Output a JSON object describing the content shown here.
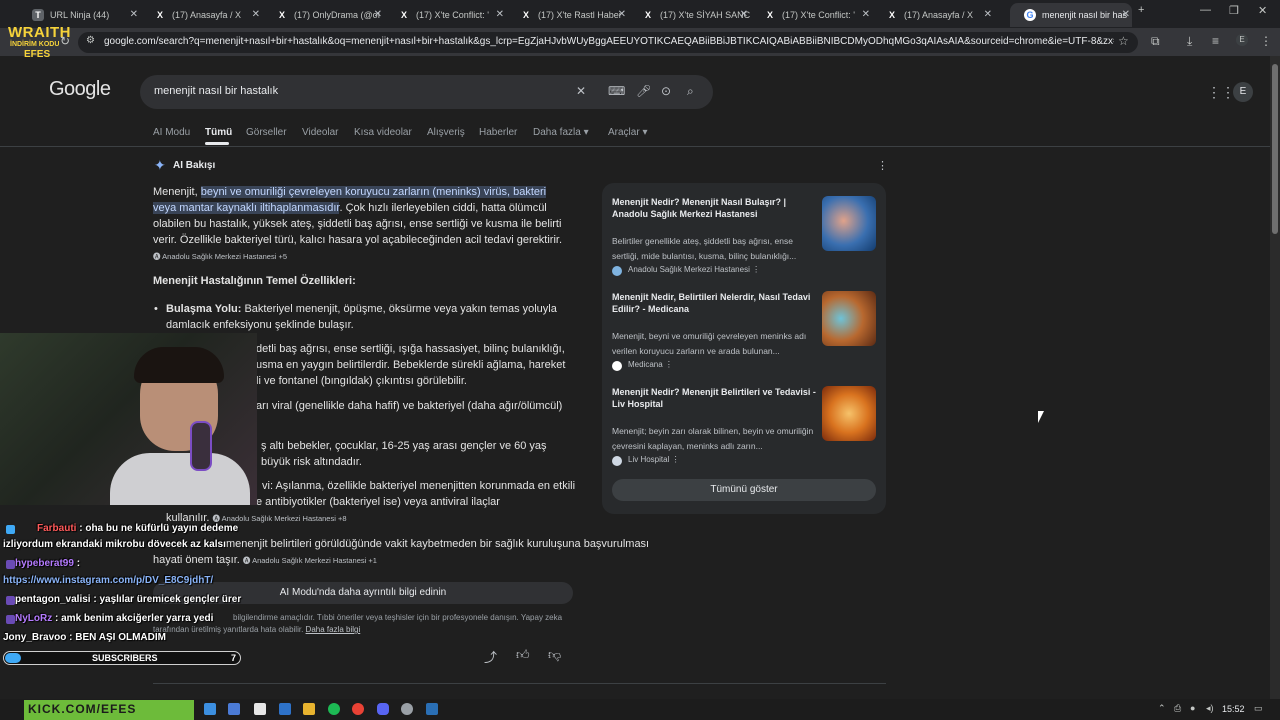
{
  "tabs": [
    {
      "title": "URL Ninja (44)",
      "icon": "T"
    },
    {
      "title": "(17) Anasayfa / X",
      "icon": "X"
    },
    {
      "title": "(17) OnlyDrama (@oı",
      "icon": "X"
    },
    {
      "title": "(17) X'te Conflict: '",
      "icon": "X"
    },
    {
      "title": "(17) X'te Rastl Haber",
      "icon": "X"
    },
    {
      "title": "(17) X'te SİYAH SANC",
      "icon": "X"
    },
    {
      "title": "(17) X'te Conflict: '",
      "icon": "X"
    },
    {
      "title": "(17) Anasayfa / X",
      "icon": "X"
    },
    {
      "title": "menenjit nasıl bir has",
      "icon": "G"
    }
  ],
  "address_bar": {
    "url": "google.com/search?q=menenjit+nasıl+bir+hastalık&oq=menenjit+nasıl+bir+hastalık&gs_lcrp=EgZjaHJvbWUyBggAEEUYOTIKCAEQABiiBBiJBTIKCAIQABiABBiiBNIBCDMyODhqMGo3qAIAsAIA&sourceid=chrome&ie=UTF-8&zx=1774183755534..."
  },
  "search": {
    "logo": "Google",
    "query": "menenjit nasıl bir hastalık",
    "avatar_letter": "E"
  },
  "nav_tabs": [
    "AI Modu",
    "Tümü",
    "Görseller",
    "Videolar",
    "Kısa videolar",
    "Alışveriş",
    "Haberler",
    "Daha fazla",
    "Araçlar"
  ],
  "ai_overview": {
    "title": "AI Bakışı",
    "intro_lead": "Menenjit, ",
    "intro_highlight": "beyni ve omuriliği çevreleyen koruyucu zarların (meninks) virüs, bakteri veya mantar kaynaklı iltihaplanmasıdır",
    "intro_rest": ". Çok hızlı ilerleyebilen ciddi, hatta ölümcül olabilen bu hastalık, yüksek ateş, şiddetli baş ağrısı, ense sertliği ve kusma ile belirti verir. Özellikle bakteriyel türü, kalıcı hasara yol açabileceğinden acil tedavi gerektirir.",
    "intro_source": "Anadolu Sağlık Merkezi Hastanesi +5",
    "heading": "Menenjit Hastalığının Temel Özellikleri:",
    "bullet1_label": "Bulaşma Yolu:",
    "bullet1_text": " Bakteriyel menenjit, öpüşme, öksürme veya yakın temas yoluyla damlacık enfeksiyonu şeklinde bulaşır.",
    "frag1": "detli baş ağrısı, ense sertliği, ışığa hassasiyet, bilinç bulanıklığı,",
    "frag2": "usma en yaygın belirtilerdir. Bebeklerde sürekli ağlama, hareket",
    "frag3": "li ve fontanel (bıngıldak) çıkıntısı görülebilir.",
    "frag4": "arı viral (genellikle daha hafif) ve bakteriyel (daha ağır/ölümcül)",
    "frag5": "ş altı bebekler, çocuklar, 16-25 yaş arası gençler ve 60 yaş",
    "frag6": "büyük risk altındadır.",
    "frag7": "vi: Aşılanma, özellikle bakteriyel menenjitten korunmada en etkili",
    "frag8": "e antibiyotikler (bakteriyel ise) veya antiviral ilaçlar",
    "frag9": "kullanılır.",
    "frag9_source": "Anadolu Sağlık Merkezi Hastanesi +8",
    "frag10": "menenjit belirtileri görüldüğünde vakit kaybetmeden bir sağlık kuruluşuna başvurulması",
    "frag11": "hayati önem taşır.",
    "frag11_source": "Anadolu Sağlık Merkezi Hastanesi +1",
    "more_button": "AI Modu'nda daha ayrıntılı bilgi edinin",
    "disclaimer": "bilgilendirme amaçlıdır. Tıbbi öneriler veya teşhisler için bir profesyonele danışın. Yapay zeka tarafından üretilmiş yanıtlarda hata olabilir.",
    "disclaimer_link": "Daha fazla bilgi"
  },
  "sources": [
    {
      "title": "Menenjit Nedir? Menenjit Nasıl Bulaşır? | Anadolu Sağlık Merkezi Hastanesi",
      "snippet": "Belirtiler genellikle ateş, şiddetli baş ağrısı, ense sertliği, mide bulantısı, kusma, bilinç bulanıklığı...",
      "site": "Anadolu Sağlık Merkezi Hastanesi",
      "thumb_color": "#3a6fb0"
    },
    {
      "title": "Menenjit Nedir, Belirtileri Nelerdir, Nasıl Tedavi Edilir? - Medicana",
      "snippet": "Menenjit, beyni ve omuriliği çevreleyen meninks adı verilen koruyucu zarların ve arada bulunan...",
      "site": "Medicana",
      "thumb_color": "#b8682f"
    },
    {
      "title": "Menenjit Nedir? Menenjit Belirtileri ve Tedavisi - Liv Hospital",
      "snippet": "Menenjit; beyin zarı olarak bilinen, beyin ve omuriliğin çevresini kaplayan, meninks adlı zarın...",
      "site": "Liv Hospital",
      "thumb_color": "#d9731f"
    }
  ],
  "show_all": "Tümünü göster",
  "overlay": {
    "brand_line1": "WRAITH",
    "brand_line2": "İNDİRİM KODU",
    "brand_line3": "EFES",
    "chat": [
      {
        "user": "Farbauti",
        "message": ": oha bu ne küfürlü yayın dedeme",
        "user_color": "#ff5a5a"
      },
      {
        "user": "",
        "message": "izliyordum ekrandaki mikrobu dövecek az kalsı",
        "user_color": "#ffffff"
      },
      {
        "user": "hypeberat99",
        "message": " :",
        "user_color": "#b57bff"
      },
      {
        "user": "",
        "message": "https://www.instagram.com/p/DV_E8C9jdhT/",
        "user_color": "#8ab4f8"
      },
      {
        "user": "pentagon_valisi",
        "message": ": yaşlılar üremicek gençler ürer",
        "user_color": "#ffffff"
      },
      {
        "user": "NyLoRz",
        "message": ": amk benim akciğerler yarra yedi",
        "user_color": "#b57bff"
      },
      {
        "user": "Jony_Bravoo",
        "message": ": BEN AŞI OLMADIM",
        "user_color": "#ffffff"
      }
    ],
    "subscribers_label": "SUBSCRIBERS",
    "subscribers_count": "7",
    "bottom_banner": "KICK.COM/EFES"
  },
  "taskbar": {
    "time": "15:52"
  },
  "colors": {
    "background": "#1f1f1f",
    "highlight": "#394457",
    "link_blue": "#8ab4f8",
    "brand_yellow": "#f6d33a"
  }
}
